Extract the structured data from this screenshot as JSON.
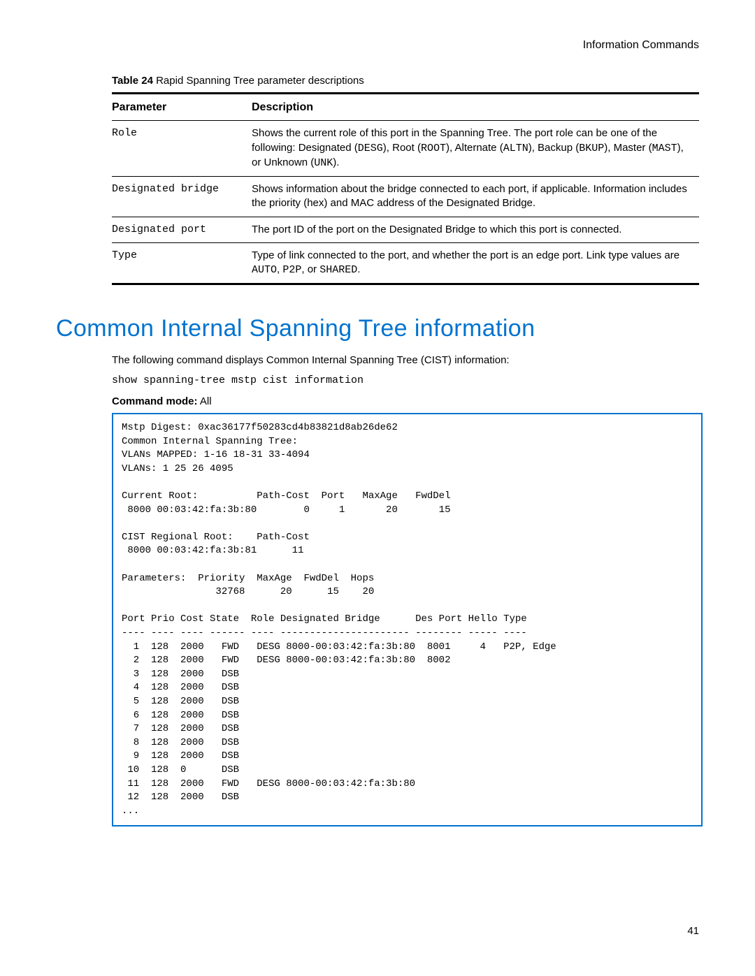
{
  "header_text": "Information Commands",
  "table_caption_label": "Table 24",
  "table_caption_text": "Rapid Spanning Tree parameter descriptions",
  "columns": {
    "parameter": "Parameter",
    "description": "Description"
  },
  "rows": [
    {
      "param": "Role",
      "desc_parts": [
        {
          "t": "Shows the current role of this port in the Spanning Tree. The port role can be one of the following: Designated ("
        },
        {
          "t": "DESG",
          "code": true
        },
        {
          "t": "), Root ("
        },
        {
          "t": "ROOT",
          "code": true
        },
        {
          "t": "), Alternate ("
        },
        {
          "t": "ALTN",
          "code": true
        },
        {
          "t": "), Backup ("
        },
        {
          "t": "BKUP",
          "code": true
        },
        {
          "t": "), Master ("
        },
        {
          "t": "MAST",
          "code": true
        },
        {
          "t": "), or Unknown ("
        },
        {
          "t": "UNK",
          "code": true
        },
        {
          "t": ")."
        }
      ]
    },
    {
      "param": "Designated bridge",
      "desc_parts": [
        {
          "t": "Shows information about the bridge connected to each port, if applicable. Information includes the priority (hex) and MAC address of the Designated Bridge."
        }
      ]
    },
    {
      "param": "Designated port",
      "desc_parts": [
        {
          "t": "The port ID of the port on the Designated Bridge to which this port is connected."
        }
      ]
    },
    {
      "param": "Type",
      "desc_parts": [
        {
          "t": "Type of link connected to the port, and whether the port is an edge port. Link type values are "
        },
        {
          "t": "AUTO",
          "code": true
        },
        {
          "t": ", "
        },
        {
          "t": "P2P",
          "code": true
        },
        {
          "t": ", or "
        },
        {
          "t": "SHARED",
          "code": true
        },
        {
          "t": "."
        }
      ]
    }
  ],
  "section_title": "Common Internal Spanning Tree information",
  "body_text": "The following command displays Common Internal Spanning Tree (CIST) information:",
  "command_text": "show spanning-tree mstp cist information",
  "command_mode_label": "Command mode:",
  "command_mode_value": "All",
  "console_output": "Mstp Digest: 0xac36177f50283cd4b83821d8ab26de62\nCommon Internal Spanning Tree:\nVLANs MAPPED: 1-16 18-31 33-4094\nVLANs: 1 25 26 4095\n\nCurrent Root:          Path-Cost  Port   MaxAge   FwdDel\n 8000 00:03:42:fa:3b:80        0     1       20       15\n\nCIST Regional Root:    Path-Cost\n 8000 00:03:42:fa:3b:81      11\n\nParameters:  Priority  MaxAge  FwdDel  Hops\n                32768      20      15    20\n\nPort Prio Cost State  Role Designated Bridge      Des Port Hello Type\n---- ---- ---- ------ ---- ---------------------- -------- ----- ----\n  1  128  2000   FWD   DESG 8000-00:03:42:fa:3b:80  8001     4   P2P, Edge\n  2  128  2000   FWD   DESG 8000-00:03:42:fa:3b:80  8002\n  3  128  2000   DSB\n  4  128  2000   DSB\n  5  128  2000   DSB\n  6  128  2000   DSB\n  7  128  2000   DSB\n  8  128  2000   DSB\n  9  128  2000   DSB\n 10  128  0      DSB\n 11  128  2000   FWD   DESG 8000-00:03:42:fa:3b:80\n 12  128  2000   DSB\n...",
  "page_number": "41"
}
